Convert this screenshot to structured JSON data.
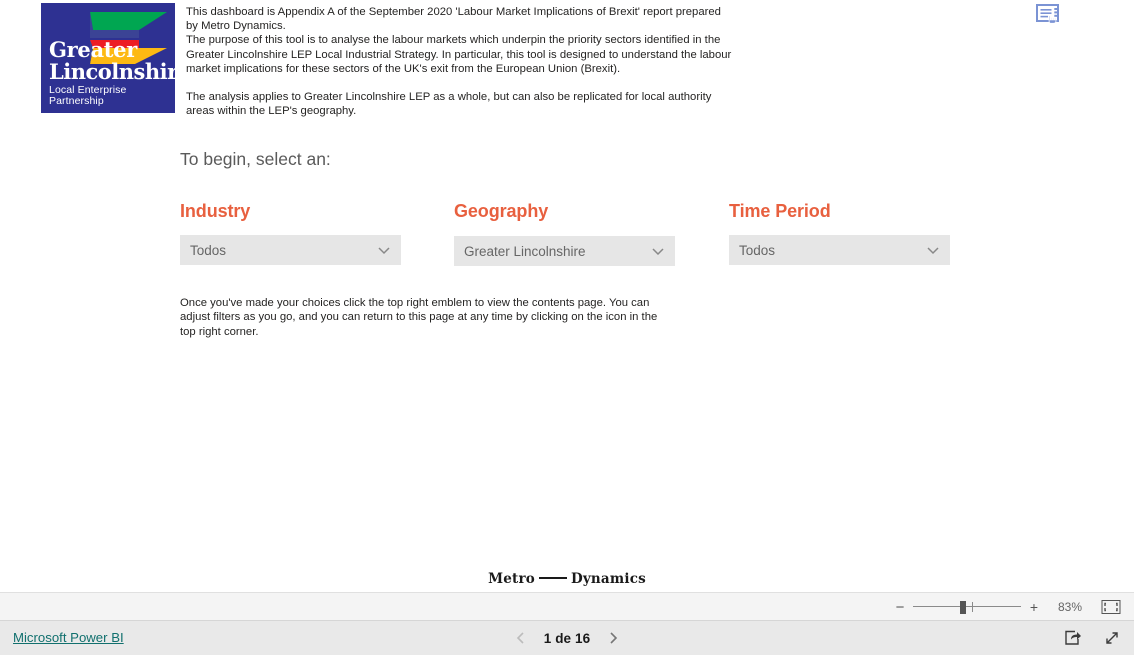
{
  "logo": {
    "line1": "Greater",
    "line2": "Lincolnshire",
    "line3": "Local Enterprise Partnership",
    "background": "#2e3192",
    "mark_colors": [
      "#00a651",
      "#3b4395",
      "#ed1c24",
      "#fdb913"
    ]
  },
  "intro": {
    "para1": "This dashboard is Appendix A of the September 2020 'Labour Market Implications of Brexit' report prepared by Metro Dynamics.",
    "para2": "The purpose of this tool is to analyse the labour markets which underpin the priority sectors identified in the Greater Lincolnshire LEP Local Industrial Strategy. In particular, this tool is designed to understand the labour market implications for these sectors of the UK's exit from the European Union (Brexit).",
    "para3": "The analysis applies to Greater Lincolnshire LEP as a whole, but can also be replicated for local authority areas within the LEP's geography."
  },
  "contents_icon": {
    "name": "contents-page-icon",
    "color": "#7b93d4"
  },
  "prompt": "To begin, select an:",
  "selectors": [
    {
      "key": "industry",
      "heading": "Industry",
      "value": "Todos",
      "chevron": "chevron-down-icon"
    },
    {
      "key": "geography",
      "heading": "Geography",
      "value": "Greater Lincolnshire",
      "chevron": "chevron-down-icon"
    },
    {
      "key": "time",
      "heading": "Time Period",
      "value": "Todos",
      "chevron": "chevron-down-icon"
    }
  ],
  "heading_color": "#e8603f",
  "footnote": "Once you've made your choices click the top right emblem to view the contents page. You can adjust filters as you go, and you can return to this page at any time by clicking on the icon in the top right corner.",
  "wordmark": {
    "left": "Metro",
    "right": "Dynamics"
  },
  "toolbar": {
    "zoom_out_label": "−",
    "zoom_in_label": "+",
    "zoom_percent": "83%",
    "fit_to_page_icon": "fit-to-page-icon"
  },
  "status": {
    "powerbi_link": "Microsoft Power BI",
    "prev_icon": "chevron-left-icon",
    "page_label": "1 de 16",
    "next_icon": "chevron-right-icon",
    "share_icon": "share-icon",
    "fullscreen_icon": "fullscreen-icon",
    "link_color": "#11706e"
  }
}
